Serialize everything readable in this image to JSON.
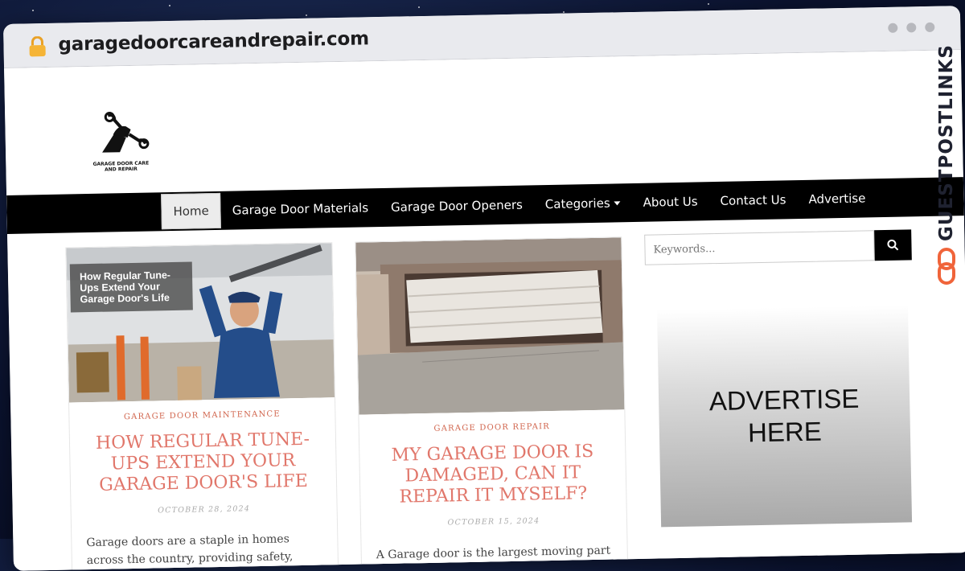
{
  "browser": {
    "url": "garagedoorcareandrepair.com"
  },
  "site": {
    "logo_text_line1": "GARAGE DOOR CARE",
    "logo_text_line2": "AND REPAIR"
  },
  "nav": {
    "items": [
      {
        "label": "Home",
        "active": true
      },
      {
        "label": "Garage Door Materials"
      },
      {
        "label": "Garage Door Openers"
      },
      {
        "label": "Categories",
        "has_dropdown": true
      },
      {
        "label": "About Us"
      },
      {
        "label": "Contact Us"
      },
      {
        "label": "Advertise"
      }
    ]
  },
  "posts": [
    {
      "image_caption": "How Regular Tune-Ups Extend Your Garage Door's Life",
      "category": "GARAGE DOOR MAINTENANCE",
      "title": "HOW REGULAR TUNE-UPS EXTEND YOUR GARAGE DOOR'S LIFE",
      "date": "OCTOBER 28, 2024",
      "excerpt": "Garage doors are a staple in homes across the country, providing safety, convenience, and"
    },
    {
      "category": "GARAGE DOOR REPAIR",
      "title": "MY GARAGE DOOR IS DAMAGED, CAN IT REPAIR IT MYSELF?",
      "date": "OCTOBER 15, 2024",
      "excerpt": "A Garage door is the largest moving part in"
    }
  ],
  "sidebar": {
    "search_placeholder": "Keywords...",
    "ad_line1": "ADVERTISE",
    "ad_line2": "HERE"
  },
  "watermark": {
    "text": "GUESTPOSTLINKS"
  },
  "colors": {
    "accent": "#e1776b",
    "category": "#d1664e",
    "nav_bg": "#000000",
    "watermark_icon": "#f0643a"
  }
}
